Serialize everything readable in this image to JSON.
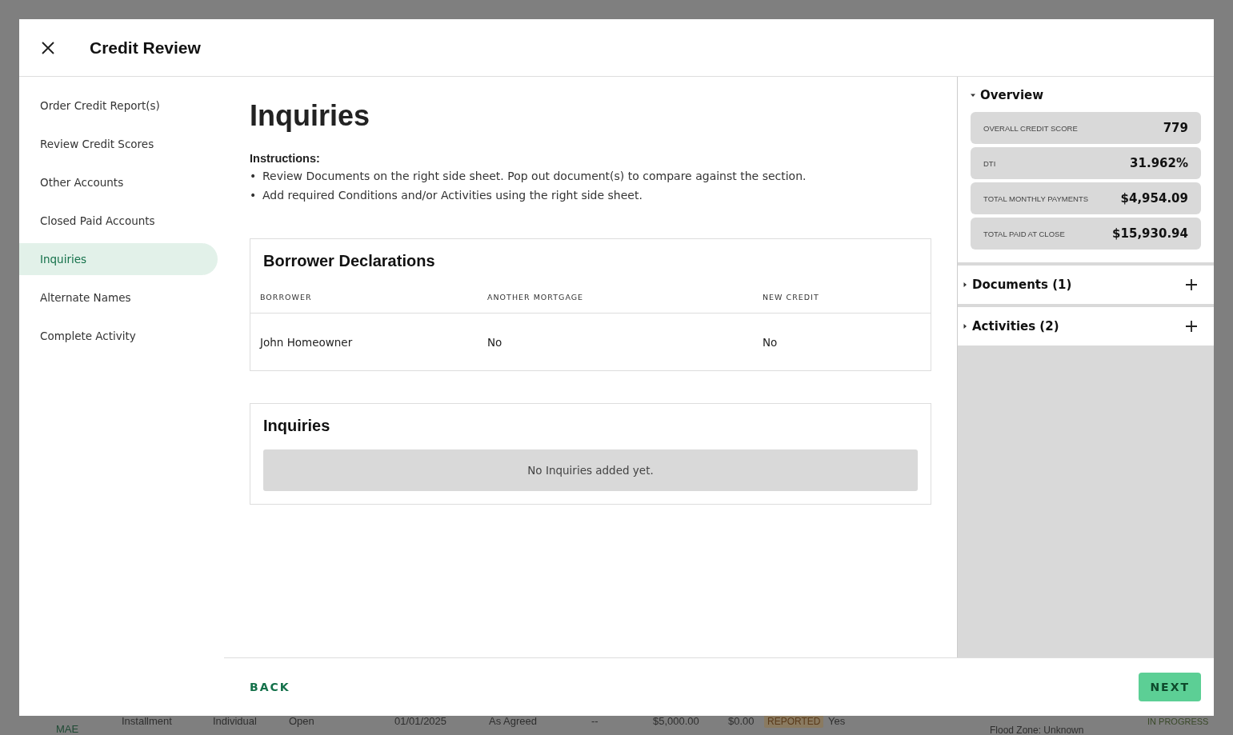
{
  "background": {
    "row": [
      "MAE",
      "Installment",
      "Individual",
      "Open",
      "01/01/2025",
      "As Agreed",
      "--",
      "$5,000.00",
      "$0.00"
    ],
    "tag": "REPORTED",
    "answer": "Yes",
    "status": "IN PROGRESS",
    "flood_zone": "Flood Zone: Unknown"
  },
  "dialog": {
    "title": "Credit Review"
  },
  "steps": [
    {
      "label": "Order Credit Report(s)",
      "selected": false
    },
    {
      "label": "Review Credit Scores",
      "selected": false
    },
    {
      "label": "Other Accounts",
      "selected": false
    },
    {
      "label": "Closed Paid Accounts",
      "selected": false
    },
    {
      "label": "Inquiries",
      "selected": true
    },
    {
      "label": "Alternate Names",
      "selected": false
    },
    {
      "label": "Complete Activity",
      "selected": false
    }
  ],
  "content": {
    "title": "Inquiries",
    "instructions_label": "Instructions:",
    "bullet": "•",
    "instructions": [
      "Review Documents on the right side sheet. Pop out document(s) to compare against the section.",
      "Add required Conditions and/or Activities using the right side sheet."
    ],
    "declarations": {
      "title": "Borrower Declarations",
      "columns": [
        "BORROWER",
        "ANOTHER MORTGAGE",
        "NEW CREDIT"
      ],
      "rows": [
        [
          "John Homeowner",
          "No",
          "No"
        ]
      ]
    },
    "inquiries": {
      "title": "Inquiries",
      "empty": "No Inquiries added yet."
    }
  },
  "side_sheet": {
    "overview": {
      "title": "Overview",
      "expanded": true,
      "stats": [
        {
          "label": "OVERALL CREDIT SCORE",
          "value": "779"
        },
        {
          "label": "DTI",
          "value": "31.962%"
        },
        {
          "label": "TOTAL MONTHLY PAYMENTS",
          "value": "$4,954.09"
        },
        {
          "label": "TOTAL PAID AT CLOSE",
          "value": "$15,930.94"
        }
      ]
    },
    "sections": [
      {
        "title": "Documents (1)",
        "expanded": false
      },
      {
        "title": "Activities (2)",
        "expanded": false
      }
    ]
  },
  "footer": {
    "back": "BACK",
    "next": "NEXT"
  }
}
